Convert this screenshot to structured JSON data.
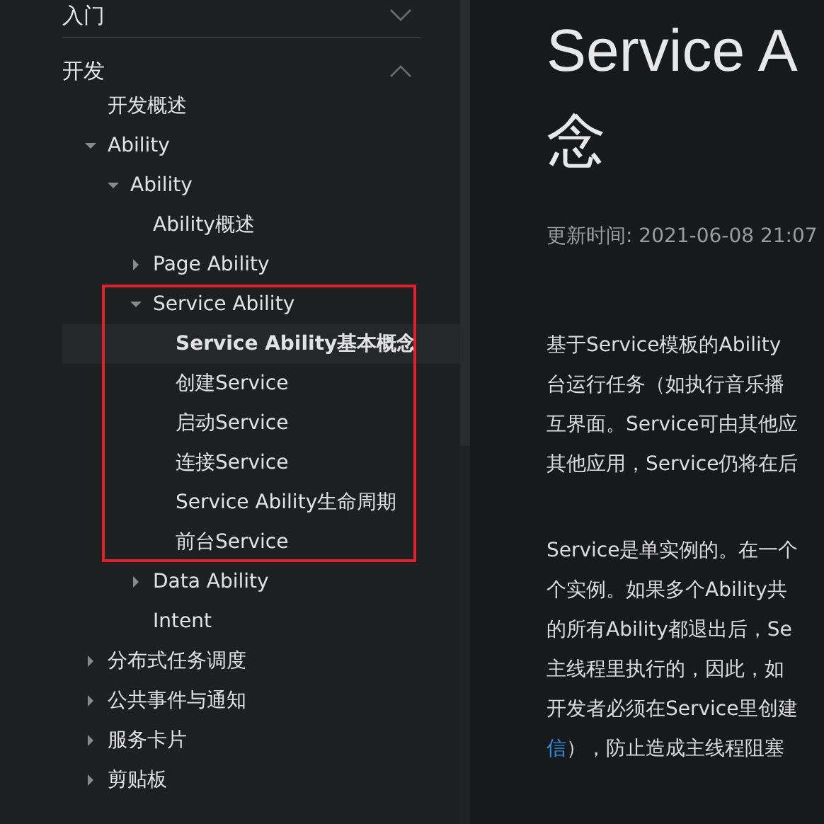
{
  "sidebar": {
    "sections": [
      {
        "title": "入门",
        "expanded": false
      },
      {
        "title": "开发",
        "expanded": true,
        "items": [
          {
            "label": "开发概述",
            "kind": "page",
            "selected": false
          },
          {
            "label": "Ability",
            "kind": "folder",
            "expanded": true,
            "selected": false,
            "children": [
              {
                "label": "Ability",
                "kind": "folder",
                "expanded": true,
                "selected": false,
                "children": [
                  {
                    "label": "Ability概述",
                    "kind": "page",
                    "selected": false
                  },
                  {
                    "label": "Page Ability",
                    "kind": "folder",
                    "expanded": false,
                    "selected": false
                  },
                  {
                    "label": "Service Ability",
                    "kind": "folder",
                    "expanded": true,
                    "selected": false,
                    "highlighted": true,
                    "children": [
                      {
                        "label": "Service Ability基本概念",
                        "kind": "page",
                        "selected": true
                      },
                      {
                        "label": "创建Service",
                        "kind": "page",
                        "selected": false
                      },
                      {
                        "label": "启动Service",
                        "kind": "page",
                        "selected": false
                      },
                      {
                        "label": "连接Service",
                        "kind": "page",
                        "selected": false
                      },
                      {
                        "label": "Service Ability生命周期",
                        "kind": "page",
                        "selected": false
                      },
                      {
                        "label": "前台Service",
                        "kind": "page",
                        "selected": false
                      }
                    ]
                  },
                  {
                    "label": "Data Ability",
                    "kind": "folder",
                    "expanded": false,
                    "selected": false
                  },
                  {
                    "label": "Intent",
                    "kind": "page",
                    "selected": false
                  }
                ]
              }
            ]
          },
          {
            "label": "分布式任务调度",
            "kind": "folder",
            "expanded": false,
            "selected": false
          },
          {
            "label": "公共事件与通知",
            "kind": "folder",
            "expanded": false,
            "selected": false
          },
          {
            "label": "服务卡片",
            "kind": "folder",
            "expanded": false,
            "selected": false
          },
          {
            "label": "剪贴板",
            "kind": "folder",
            "expanded": false,
            "selected": false
          }
        ]
      }
    ]
  },
  "article": {
    "title_lines": [
      "Service A",
      "念"
    ],
    "updated": "更新时间: 2021-06-08 21:07",
    "paragraphs": [
      {
        "lines": [
          {
            "text": "基于Service模板的Ability"
          },
          {
            "text": "台运行任务（如执行音乐播"
          },
          {
            "text": "互界面。Service可由其他应"
          },
          {
            "text": "其他应用，Service仍将在后"
          }
        ]
      },
      {
        "lines": [
          {
            "text": "Service是单实例的。在一个"
          },
          {
            "text": "个实例。如果多个Ability共"
          },
          {
            "text": "的所有Ability都退出后，Se"
          },
          {
            "text": "主线程里执行的，因此，如"
          },
          {
            "text": "开发者必须在Service里创建"
          },
          {
            "text": "），防止造成主线程阻塞",
            "link": "信"
          }
        ]
      }
    ]
  }
}
